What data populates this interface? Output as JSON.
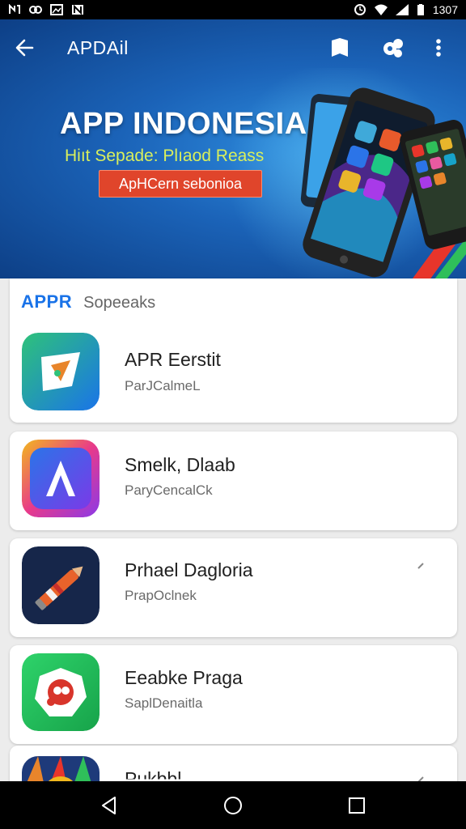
{
  "status_bar": {
    "time": "1307"
  },
  "app_bar": {
    "title": "APDAil"
  },
  "banner": {
    "title": "APP INDONESIA",
    "subtitle": "Hiıt Sepade: Plıaod Reass",
    "cta_label": "ApHCern sebonioa"
  },
  "section": {
    "title": "APPR",
    "subtitle": "Sopeeaks"
  },
  "apps": [
    {
      "name": "APR Eerstit",
      "sub": "ParJCalmeL"
    },
    {
      "name": "Smelk, Dlaab",
      "sub": "ParyCencalCk"
    },
    {
      "name": "Prhael Dagloria",
      "sub": "PrapOclnek"
    },
    {
      "name": "Eeabke Praga",
      "sub": "SaplDenaitla"
    },
    {
      "name": "Pukbbl",
      "sub": ""
    }
  ],
  "icons": {
    "back": "arrow-left-icon",
    "bookmark": "bookmark-icon",
    "group": "people-icon",
    "more": "more-vert-icon",
    "nav_back": "triangle-back-icon",
    "nav_home": "circle-home-icon",
    "nav_recents": "square-recents-icon"
  },
  "colors": {
    "accent": "#1a73e8",
    "cta": "#e0452b",
    "banner": "#1b63b8"
  }
}
